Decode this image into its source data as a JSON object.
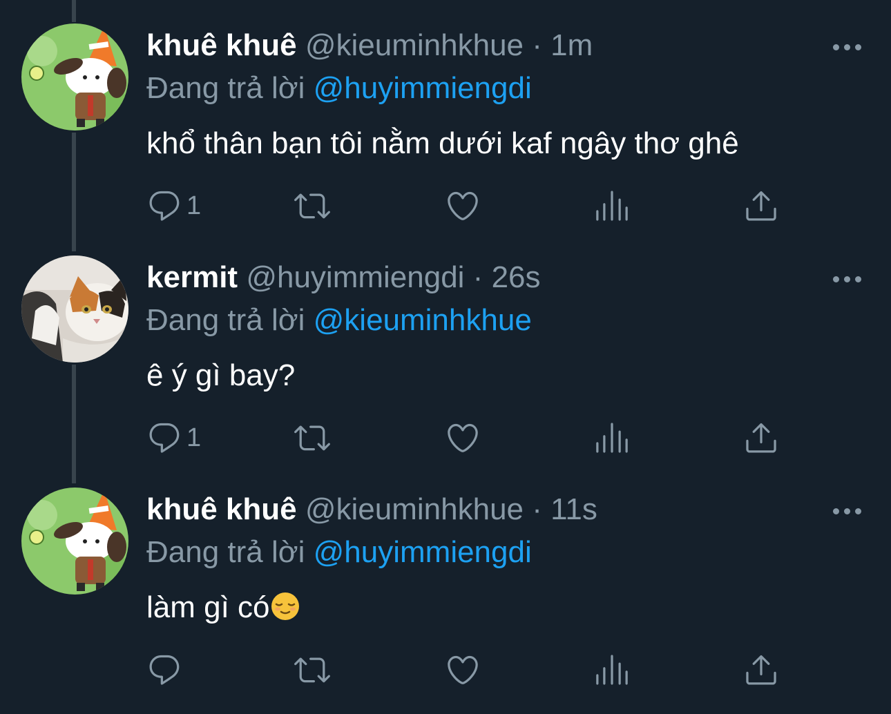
{
  "tweets": [
    {
      "name": "khuê khuê",
      "handle": "@kieuminhkhue",
      "separator": "·",
      "time": "1m",
      "replying_prefix": "Đang trả lời",
      "replying_to": "@huyimmiengdi",
      "text": "khổ thân bạn tôi nằm dưới kaf ngây thơ ghê",
      "reply_count": "1",
      "avatar": "avatar-character-with-traffic-cone-hat"
    },
    {
      "name": "kermit",
      "handle": "@huyimmiengdi",
      "separator": "·",
      "time": "26s",
      "replying_prefix": "Đang trả lời",
      "replying_to": "@kieuminhkhue",
      "text": "ê ý gì bay?",
      "reply_count": "1",
      "avatar": "avatar-calico-cat"
    },
    {
      "name": "khuê khuê",
      "handle": "@kieuminhkhue",
      "separator": "·",
      "time": "11s",
      "replying_prefix": "Đang trả lời",
      "replying_to": "@huyimmiengdi",
      "text": "làm gì có",
      "reply_count": "",
      "emoji": "relieved-face-emoji",
      "avatar": "avatar-character-with-traffic-cone-hat"
    }
  ],
  "icons": [
    "more-icon",
    "reply-icon",
    "retweet-icon",
    "like-icon",
    "analytics-icon",
    "share-icon"
  ],
  "colors": {
    "background": "#15202b",
    "secondary_text": "#8899a6",
    "mention": "#1da1f2",
    "thread_line": "#38444d"
  }
}
